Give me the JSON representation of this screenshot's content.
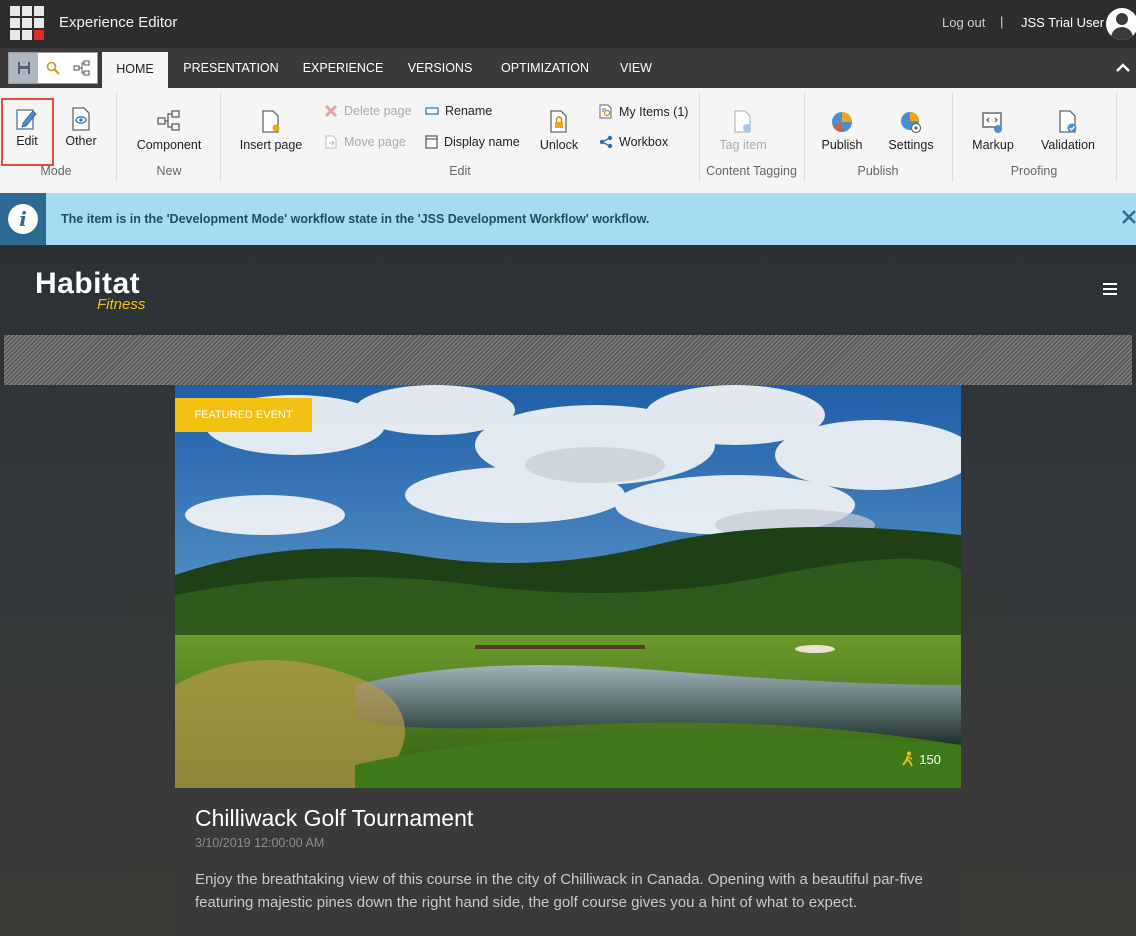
{
  "app": {
    "title": "Experience Editor",
    "logout": "Log out",
    "separator": "|",
    "user": "JSS Trial User"
  },
  "tabs": [
    "HOME",
    "PRESENTATION",
    "EXPERIENCE",
    "VERSIONS",
    "OPTIMIZATION",
    "VIEW"
  ],
  "ribbon": {
    "mode": {
      "edit": "Edit",
      "other": "Other",
      "group": "Mode"
    },
    "new": {
      "component": "Component",
      "group": "New"
    },
    "edit": {
      "insert_page": "Insert page",
      "delete_page": "Delete page",
      "move_page": "Move page",
      "rename": "Rename",
      "display_name": "Display name",
      "unlock": "Unlock",
      "my_items": "My Items (1)",
      "workbox": "Workbox",
      "group": "Edit"
    },
    "content_tagging": {
      "tag_item": "Tag item",
      "group": "Content Tagging"
    },
    "publish": {
      "publish": "Publish",
      "settings": "Settings",
      "group": "Publish"
    },
    "proofing": {
      "markup": "Markup",
      "validation": "Validation",
      "group": "Proofing"
    }
  },
  "notification": {
    "text": "The item is in the 'Development Mode' workflow state in the 'JSS Development Workflow' workflow."
  },
  "site": {
    "logo_main": "Habitat",
    "logo_sub": "Fitness",
    "event": {
      "badge": "FEATURED EVENT",
      "count": "150",
      "title": "Chilliwack Golf Tournament",
      "date": "3/10/2019 12:00:00 AM",
      "description": "Enjoy the breathtaking view of this course in the city of Chilliwack in Canada. Opening with a beautiful par-five featuring majestic pines down the right hand side, the golf course gives you a hint of what to expect."
    }
  },
  "colors": {
    "accent": "#f2c011",
    "info_bg": "#a6dcef",
    "highlight": "#e54d35"
  }
}
